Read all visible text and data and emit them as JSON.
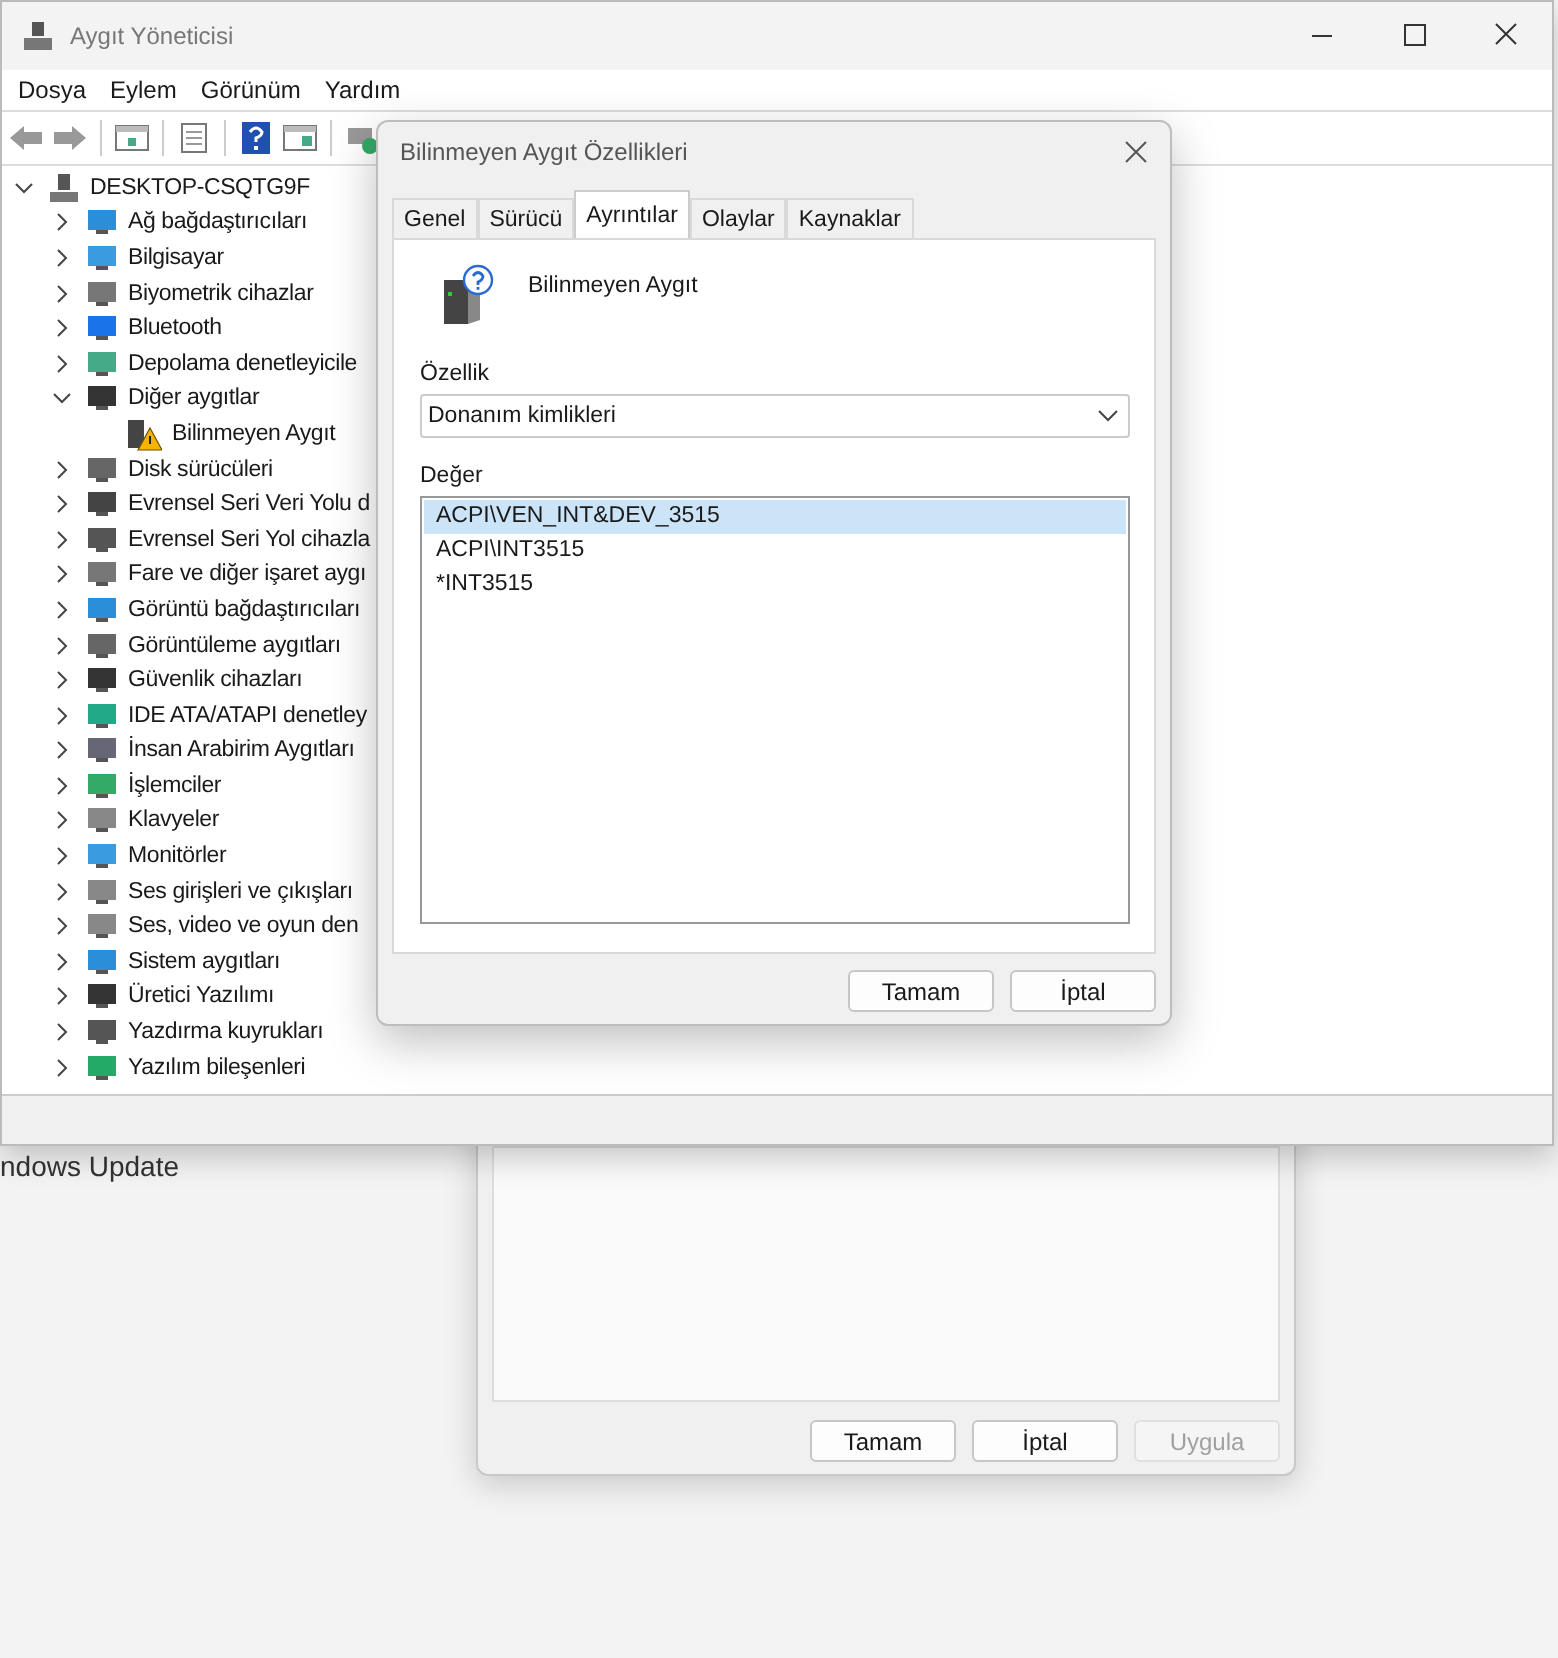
{
  "background": {
    "partial_text": "ndows Update"
  },
  "back_dialog": {
    "buttons": [
      {
        "label": "Tamam",
        "disabled": false
      },
      {
        "label": "İptal",
        "disabled": false
      },
      {
        "label": "Uygula",
        "disabled": true
      }
    ]
  },
  "device_manager": {
    "title": "Aygıt Yöneticisi",
    "menu": [
      "Dosya",
      "Eylem",
      "Görünüm",
      "Yardım"
    ],
    "tree": {
      "label": "DESKTOP-CSQTG9F",
      "expanded": true,
      "children": [
        {
          "label": "Ağ bağdaştırıcıları",
          "expanded": false
        },
        {
          "label": "Bilgisayar",
          "expanded": false
        },
        {
          "label": "Biyometrik cihazlar",
          "expanded": false
        },
        {
          "label": "Bluetooth",
          "expanded": false
        },
        {
          "label": "Depolama denetleyicile",
          "expanded": false
        },
        {
          "label": "Diğer aygıtlar",
          "expanded": true,
          "children": [
            {
              "label": "Bilinmeyen Aygıt"
            }
          ]
        },
        {
          "label": "Disk sürücüleri",
          "expanded": false
        },
        {
          "label": "Evrensel Seri Veri Yolu d",
          "expanded": false
        },
        {
          "label": "Evrensel Seri Yol cihazla",
          "expanded": false
        },
        {
          "label": "Fare ve diğer işaret aygı",
          "expanded": false
        },
        {
          "label": "Görüntü bağdaştırıcıları",
          "expanded": false
        },
        {
          "label": "Görüntüleme aygıtları",
          "expanded": false
        },
        {
          "label": "Güvenlik cihazları",
          "expanded": false
        },
        {
          "label": "IDE ATA/ATAPI denetley",
          "expanded": false
        },
        {
          "label": "İnsan Arabirim Aygıtları",
          "expanded": false
        },
        {
          "label": "İşlemciler",
          "expanded": false
        },
        {
          "label": "Klavyeler",
          "expanded": false
        },
        {
          "label": "Monitörler",
          "expanded": false
        },
        {
          "label": "Ses girişleri ve çıkışları",
          "expanded": false
        },
        {
          "label": "Ses, video ve oyun den",
          "expanded": false
        },
        {
          "label": "Sistem aygıtları",
          "expanded": false
        },
        {
          "label": "Üretici Yazılımı",
          "expanded": false
        },
        {
          "label": "Yazdırma kuyrukları",
          "expanded": false
        },
        {
          "label": "Yazılım bileşenleri",
          "expanded": false
        }
      ]
    }
  },
  "properties_dialog": {
    "title": "Bilinmeyen Aygıt Özellikleri",
    "tabs": [
      {
        "label": "Genel",
        "selected": false
      },
      {
        "label": "Sürücü",
        "selected": false
      },
      {
        "label": "Ayrıntılar",
        "selected": true
      },
      {
        "label": "Olaylar",
        "selected": false
      },
      {
        "label": "Kaynaklar",
        "selected": false
      }
    ],
    "device_name": "Bilinmeyen Aygıt",
    "property_label": "Özellik",
    "property_value": "Donanım kimlikleri",
    "value_label": "Değer",
    "values": [
      {
        "text": "ACPI\\VEN_INT&DEV_3515",
        "selected": true
      },
      {
        "text": "ACPI\\INT3515",
        "selected": false
      },
      {
        "text": "*INT3515",
        "selected": false
      }
    ],
    "buttons": [
      {
        "label": "Tamam",
        "disabled": false
      },
      {
        "label": "İptal",
        "disabled": false
      }
    ]
  }
}
